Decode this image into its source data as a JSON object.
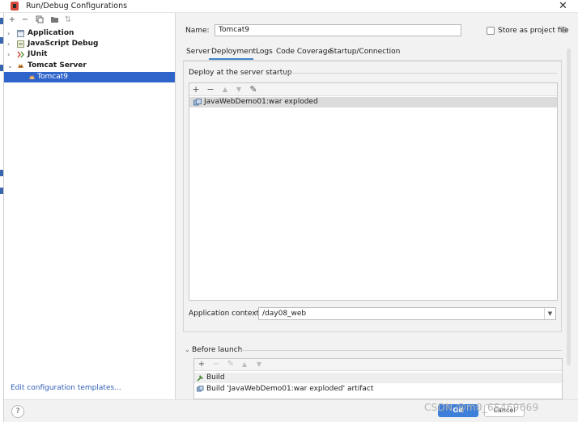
{
  "window": {
    "title": "Run/Debug Configurations",
    "close_glyph": "✕"
  },
  "left_toolbar": {
    "icons": [
      "add-icon",
      "remove-icon",
      "copy-icon",
      "folder-icon",
      "sort-icon"
    ]
  },
  "tree": {
    "items": [
      {
        "label": "Application",
        "expanded": false,
        "icon": "application-icon"
      },
      {
        "label": "JavaScript Debug",
        "expanded": false,
        "icon": "javascript-debug-icon"
      },
      {
        "label": "JUnit",
        "expanded": false,
        "icon": "junit-icon"
      },
      {
        "label": "Tomcat Server",
        "expanded": true,
        "icon": "tomcat-icon"
      }
    ],
    "selected_child": {
      "label": "Tomcat9",
      "icon": "tomcat-icon"
    }
  },
  "edit_templates": "Edit configuration templates...",
  "name_field": {
    "label": "Name:",
    "value": "Tomcat9"
  },
  "store_project": {
    "label": "Store as project file",
    "checked": false
  },
  "tabs": [
    {
      "label": "Server",
      "active": false
    },
    {
      "label": "Deployment",
      "active": true
    },
    {
      "label": "Logs",
      "active": false
    },
    {
      "label": "Code Coverage",
      "active": false
    },
    {
      "label": "Startup/Connection",
      "active": false
    }
  ],
  "deployment": {
    "section_title": "Deploy at the server startup",
    "toolbar_icons": [
      "add-icon",
      "remove-icon",
      "move-up-icon",
      "move-down-icon",
      "edit-icon"
    ],
    "artifacts": [
      "JavaWebDemo01:war exploded"
    ]
  },
  "app_context": {
    "label": "Application context:",
    "value": "/day08_web"
  },
  "before_launch": {
    "title": "Before launch",
    "items": [
      "Build",
      "Build 'JavaWebDemo01:war exploded' artifact"
    ]
  },
  "buttons": {
    "help": "?",
    "ok": "OK",
    "cancel": "Cancel"
  },
  "watermark": "CSDN @m0_65469669",
  "colors": {
    "selection": "#2f65ca",
    "accent": "#4083c9",
    "ok_button": "#3d7fd9"
  }
}
